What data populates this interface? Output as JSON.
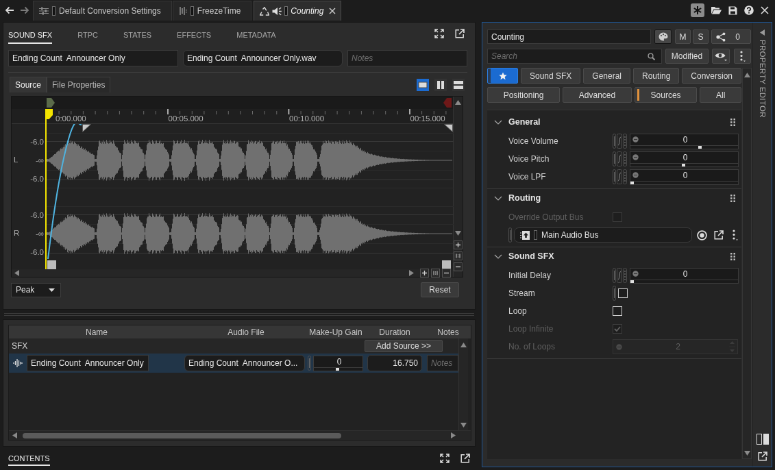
{
  "window_tabs": [
    {
      "kind": "conversion",
      "label": "Default Conversion Settings",
      "selected": false
    },
    {
      "kind": "state",
      "label": "FreezeTime",
      "selected": false
    },
    {
      "kind": "sound",
      "label": "Counting",
      "selected": true
    }
  ],
  "object_editor": {
    "tabs": [
      {
        "label": "SOUND SFX",
        "selected": true
      },
      {
        "label": "RTPC",
        "selected": false
      },
      {
        "label": "STATES",
        "selected": false
      },
      {
        "label": "EFFECTS",
        "selected": false
      },
      {
        "label": "METADATA",
        "selected": false
      }
    ],
    "name_field": {
      "value": "Ending Count  Announcer Only"
    },
    "audio_file_field": {
      "value": "Ending Count  Announcer Only.wav"
    },
    "notes_field": {
      "placeholder": "Notes"
    },
    "source_tabs": [
      {
        "label": "Source",
        "selected": true
      },
      {
        "label": "File Properties",
        "selected": false
      }
    ],
    "view_modes": [
      {
        "kind": "single",
        "selected": true
      },
      {
        "kind": "side_by_side",
        "selected": false
      },
      {
        "kind": "stacked",
        "selected": false
      }
    ],
    "waveform": {
      "time_labels": [
        "0:00.000",
        "00:05.000",
        "00:10.000",
        "00:15.000"
      ],
      "channels": [
        {
          "label": "L",
          "db_labels": [
            "-6.0",
            "-∞",
            "-6.0"
          ]
        },
        {
          "label": "R",
          "db_labels": [
            "-6.0",
            "-∞",
            "-6.0"
          ]
        }
      ]
    },
    "display_mode": {
      "value": "Peak"
    },
    "reset_button": {
      "label": "Reset"
    }
  },
  "sources_table": {
    "columns": [
      "Name",
      "Audio File",
      "Make-Up Gain",
      "Duration",
      "Notes"
    ],
    "groups": [
      {
        "label": "SFX",
        "add_button": "Add Source >>",
        "rows": [
          {
            "selected": true,
            "name": "Ending Count  Announcer Only",
            "audio_file": "Ending Count  Announcer O...",
            "makeup_gain": {
              "value": "0",
              "level": 0.5
            },
            "duration": "16.750",
            "notes": {
              "placeholder": "Notes"
            }
          }
        ]
      }
    ]
  },
  "contents_tab": {
    "label": "CONTENTS",
    "selected": true
  },
  "property_editor": {
    "title": "PROPERTY EDITOR",
    "object_name": {
      "value": "Counting"
    },
    "mute_button": {
      "label": "M"
    },
    "solo_button": {
      "label": "S"
    },
    "references": {
      "count": "0"
    },
    "search": {
      "placeholder": "Search"
    },
    "modified_button": {
      "label": "Modified"
    },
    "filter_rows": [
      {
        "filters": [
          {
            "kind": "favorites",
            "selected": true,
            "marked": false
          },
          {
            "kind": "category",
            "label": "Sound SFX",
            "selected": false,
            "marked": false
          },
          {
            "kind": "category",
            "label": "General",
            "selected": false,
            "marked": false
          },
          {
            "kind": "category",
            "label": "Routing",
            "selected": false,
            "marked": false
          },
          {
            "kind": "category",
            "label": "Conversion",
            "selected": false,
            "marked": false
          }
        ]
      },
      {
        "filters": [
          {
            "kind": "category",
            "label": "Positioning",
            "selected": false,
            "marked": false
          },
          {
            "kind": "category",
            "label": "Advanced",
            "selected": false,
            "marked": false
          },
          {
            "kind": "category",
            "label": "Sources",
            "selected": false,
            "marked": true
          },
          {
            "kind": "category",
            "label": "All",
            "selected": false,
            "marked": false
          }
        ]
      }
    ],
    "sections": [
      {
        "title": "General",
        "expanded": true,
        "properties": [
          {
            "kind": "slider",
            "label": "Voice Volume",
            "value": "0",
            "level": 0.66,
            "disabled": false
          },
          {
            "kind": "slider",
            "label": "Voice Pitch",
            "value": "0",
            "level": 0.5,
            "disabled": false
          },
          {
            "kind": "slider",
            "label": "Voice LPF",
            "value": "0",
            "level": 0,
            "disabled": false
          }
        ]
      },
      {
        "title": "Routing",
        "expanded": true,
        "properties": [
          {
            "kind": "checkbox",
            "label": "Override Output Bus",
            "checked": false,
            "disabled": true,
            "linkable": false
          },
          {
            "kind": "bus",
            "value": "Main Audio Bus",
            "disabled": false
          }
        ]
      },
      {
        "title": "Sound SFX",
        "expanded": true,
        "properties": [
          {
            "kind": "slider",
            "label": "Initial Delay",
            "value": "0",
            "level": 0,
            "disabled": false
          },
          {
            "kind": "checkbox",
            "label": "Stream",
            "checked": false,
            "disabled": false,
            "linkable": true
          },
          {
            "kind": "checkbox",
            "label": "Loop",
            "checked": false,
            "disabled": false,
            "linkable": false
          },
          {
            "kind": "checkbox",
            "label": "Loop Infinite",
            "checked": true,
            "disabled": true,
            "linkable": false
          },
          {
            "kind": "spinner",
            "label": "No. of Loops",
            "value": "2",
            "disabled": true
          }
        ]
      }
    ]
  }
}
